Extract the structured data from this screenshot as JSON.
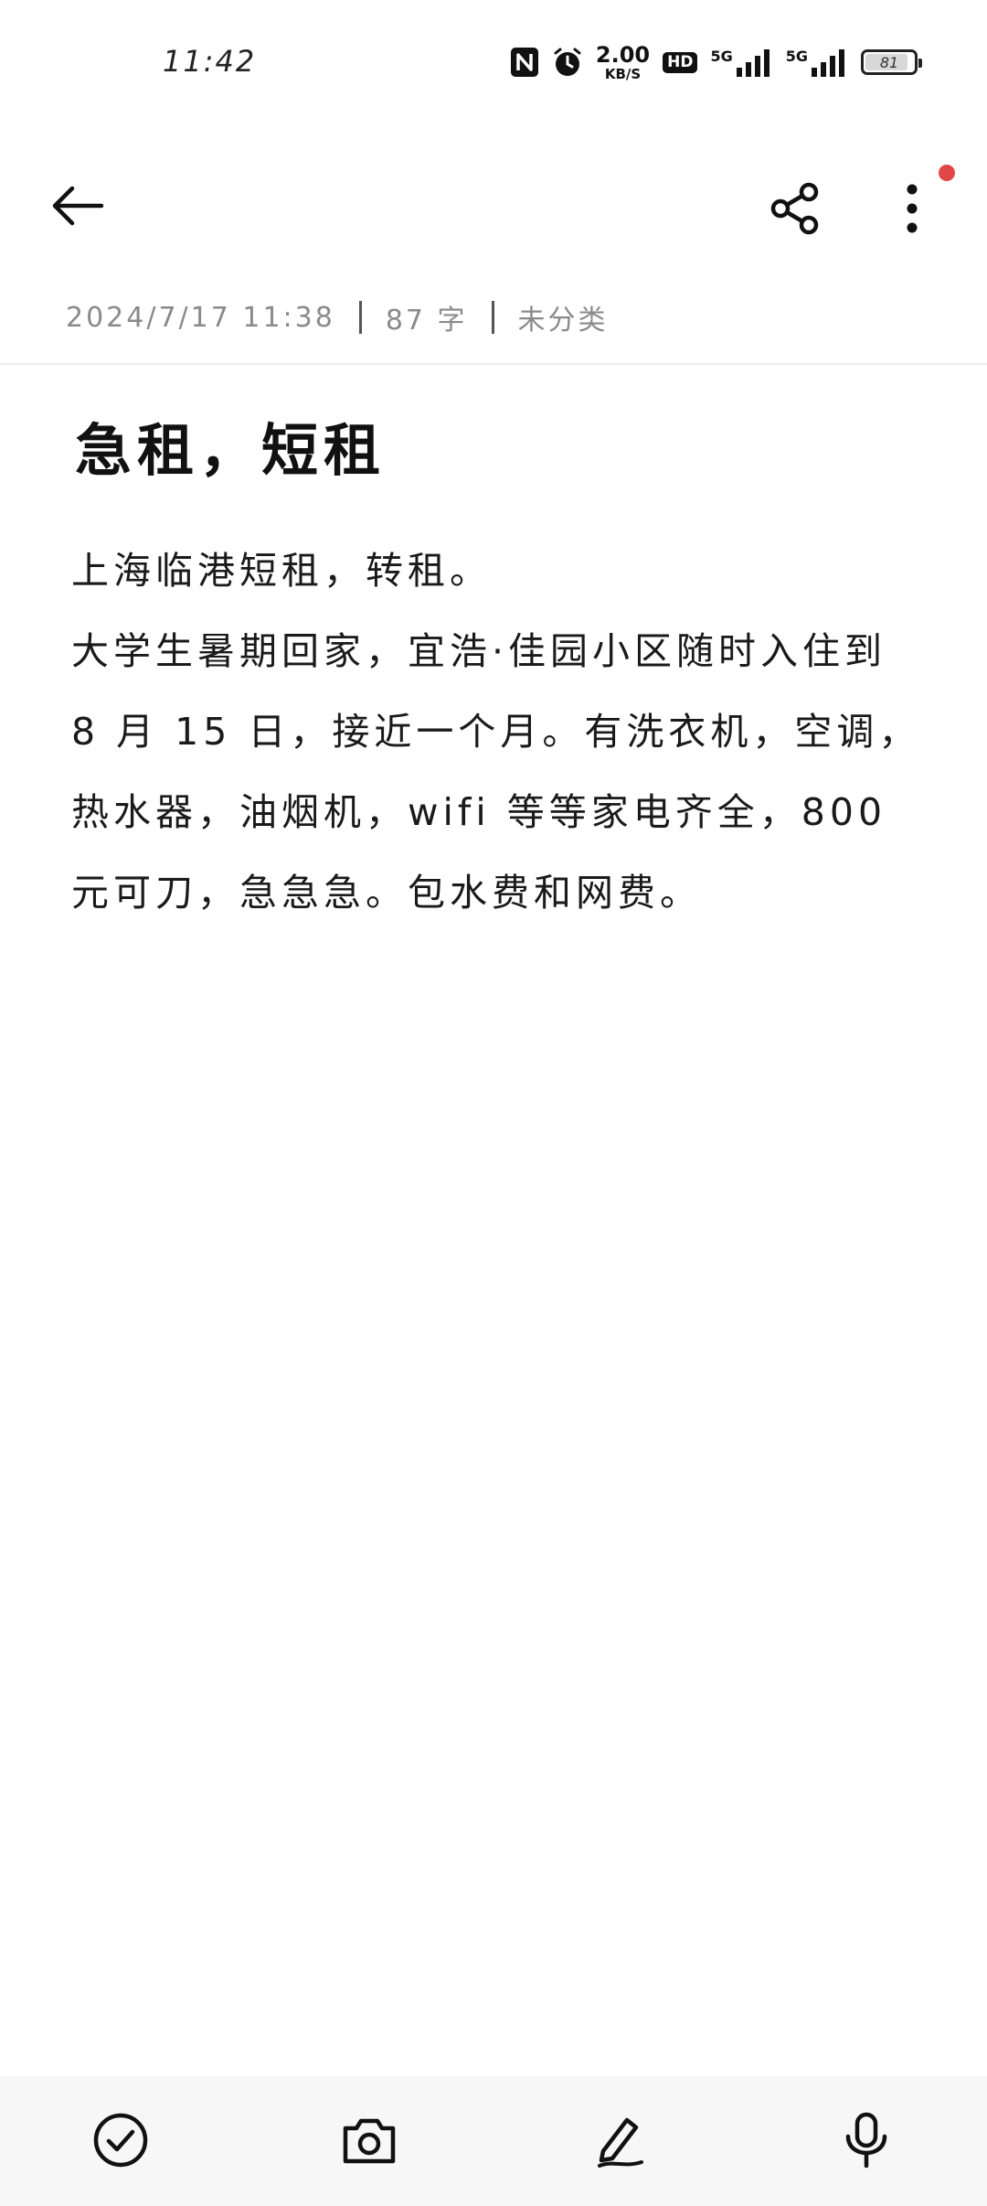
{
  "status_bar": {
    "time": "11:42",
    "network_speed_value": "2.00",
    "network_speed_unit": "KB/S",
    "hd_label": "HD",
    "signal_1_label": "5G",
    "signal_2_label": "5G",
    "battery_level": "81",
    "icons": [
      "nfc-icon",
      "alarm-icon",
      "hd-voice-icon",
      "signal-icon",
      "battery-icon"
    ]
  },
  "app_bar": {
    "icons": [
      "back-arrow-icon",
      "share-icon",
      "more-vertical-icon"
    ],
    "notification_dot_color": "#e04848"
  },
  "meta": {
    "datetime": "2024/7/17 11:38",
    "word_count": "87 字",
    "category": "未分类"
  },
  "note": {
    "title": "急租，短租",
    "lines": [
      "上海临港短租，转租。",
      "大学生暑期回家，宜浩·佳园小区随时入住到",
      "8 月 15 日，接近一个月。有洗衣机，空调，",
      "热水器，油烟机，wifi 等等家电齐全，800",
      "元可刀，急急急。包水费和网费。"
    ]
  },
  "bottom_toolbar": {
    "icons": [
      "checklist-icon",
      "camera-icon",
      "pen-icon",
      "microphone-icon"
    ]
  }
}
